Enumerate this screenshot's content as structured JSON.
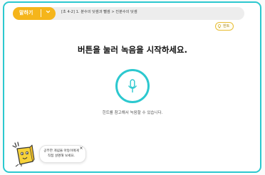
{
  "header": {
    "mode_label": "말하기",
    "breadcrumb": "[초 4-2] 1. 분수의 덧셈과 뺄셈 > 진분수의 덧셈"
  },
  "hint": {
    "label": "힌트",
    "icon": "lightbulb-icon"
  },
  "main": {
    "title": "버튼을 눌러 녹음을 시작하세요.",
    "mic_icon": "microphone-icon",
    "instruction": "힌트를 참고해서 녹음할 수 있습니다."
  },
  "assistant": {
    "message": "공부한 개념을 아동이에게 직접 설명해 보세요.",
    "close_label": "×"
  },
  "colors": {
    "accent": "#2cc8cf",
    "mode_pill": "#f5b51b",
    "hint_border": "#e8bd35"
  }
}
